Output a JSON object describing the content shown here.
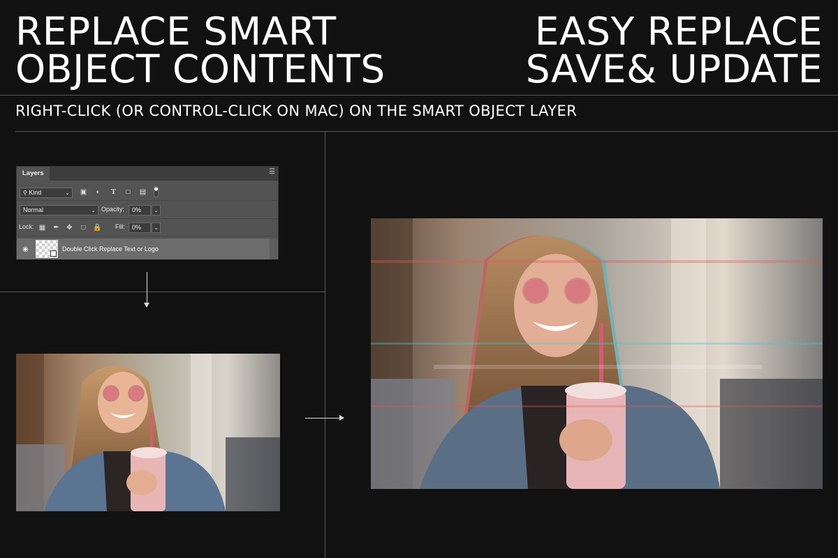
{
  "headline_left": {
    "line1": "REPLACE SMART",
    "line2": "OBJECT CONTENTS"
  },
  "headline_right": {
    "line1": "EASY REPLACE",
    "line2": "SAVE& UPDATE"
  },
  "instruction": "RIGHT-CLICK (OR CONTROL-CLICK ON MAC) ON THE SMART OBJECT LAYER",
  "layers_panel": {
    "tab_label": "Layers",
    "filter": {
      "value": "Kind",
      "icons": [
        "image-filter-icon",
        "adjustment-filter-icon",
        "type-filter-icon",
        "shape-filter-icon",
        "smart-object-filter-icon",
        "filter-toggle-icon"
      ]
    },
    "blend_mode": "Normal",
    "opacity_label": "Opacity:",
    "opacity_value": "0%",
    "lock_label": "Lock:",
    "lock_icons": [
      "lock-transparent-icon",
      "lock-paint-icon",
      "lock-position-icon",
      "lock-artboard-icon",
      "lock-all-icon"
    ],
    "fill_label": "Fill:",
    "fill_value": "0%",
    "layer": {
      "name": "Double Click Replace Text or Logo",
      "visible": true
    }
  },
  "colors": {
    "background": "#111111",
    "panel": "#535353",
    "panel_dark": "#3d3d3d",
    "selected_layer": "#6c6c6c",
    "text": "#ffffff"
  },
  "images": [
    {
      "role": "original-photo",
      "depicts": "smiling woman in rose sunglasses holding milkshake"
    },
    {
      "role": "glitch-result-photo",
      "depicts": "same photo with RGB glitch effect"
    }
  ]
}
